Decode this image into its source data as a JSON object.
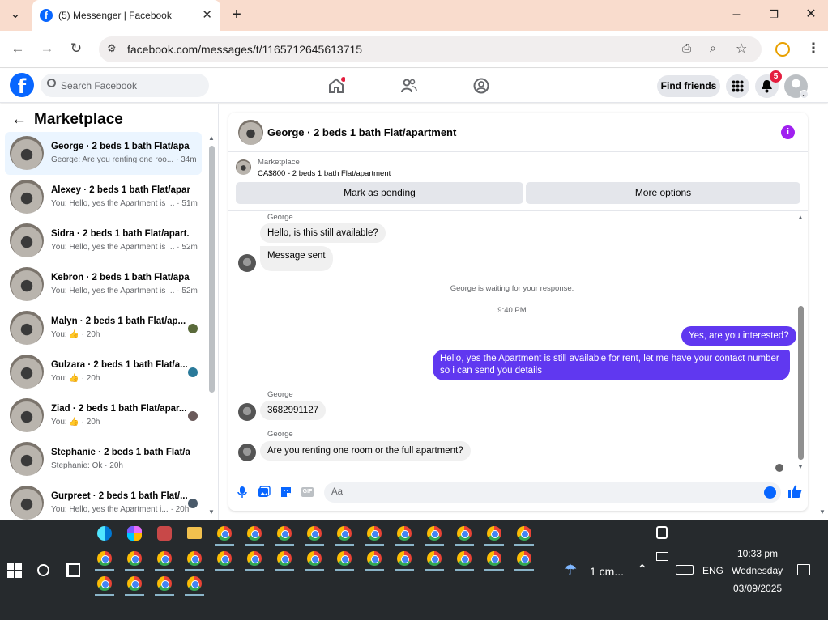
{
  "browser": {
    "tab_title": "(5) Messenger | Facebook",
    "url": "facebook.com/messages/t/1165712645613715"
  },
  "header": {
    "search_placeholder": "Search Facebook",
    "find_friends": "Find friends",
    "notification_count": "5"
  },
  "sidebar": {
    "title": "Marketplace",
    "conversations": [
      {
        "name": "George · 2 beds 1 bath Flat/apa...",
        "preview": "George: Are you renting one roo... · 34m"
      },
      {
        "name": "Alexey · 2 beds 1 bath Flat/apar...",
        "preview": "You: Hello, yes the Apartment is ... · 51m"
      },
      {
        "name": "Sidra · 2 beds 1 bath Flat/apart...",
        "preview": "You: Hello, yes the Apartment is ... · 52m"
      },
      {
        "name": "Kebron · 2 beds 1 bath Flat/apa...",
        "preview": "You: Hello, yes the Apartment is ... · 52m"
      },
      {
        "name": "Malyn · 2 beds 1 bath Flat/ap...",
        "preview": "You: 👍 · 20h"
      },
      {
        "name": "Gulzara · 2 beds 1 bath Flat/a...",
        "preview": "You: 👍 · 20h"
      },
      {
        "name": "Ziad · 2 beds 1 bath Flat/apar...",
        "preview": "You: 👍 · 20h"
      },
      {
        "name": "Stephanie · 2 beds 1 bath Flat/a...",
        "preview": "Stephanie: Ok · 20h"
      },
      {
        "name": "Gurpreet · 2 beds 1 bath Flat/...",
        "preview": "You: Hello, yes the Apartment i... · 20h"
      }
    ]
  },
  "chat": {
    "title": "George · 2 beds 1 bath Flat/apartment",
    "listing_label": "Marketplace",
    "listing_price": "CA$800 - 2 beds 1 bath Flat/apartment",
    "mark_pending": "Mark as pending",
    "more_options": "More options",
    "messages": {
      "sender1": "George",
      "m1": "Hello, is this still available?",
      "m2": "Message sent",
      "system": "George is waiting for your response.",
      "time": "9:40 PM",
      "out1": "Yes, are you interested?",
      "out2": "Hello, yes the Apartment is still available for rent, let me have your contact number so i can send you details",
      "sender2": "George",
      "m3": "3682991127",
      "sender3": "George",
      "m4": "Are you renting one room or the full apartment?"
    },
    "composer_placeholder": "Aa"
  },
  "taskbar": {
    "weather": "1 cm...",
    "lang": "ENG",
    "time": "10:33 pm",
    "day": "Wednesday",
    "date": "03/09/2025"
  },
  "colors": {
    "fb_blue": "#0866ff",
    "outgoing_bubble": "#6038f0",
    "tab_strip": "#f9dccd"
  }
}
